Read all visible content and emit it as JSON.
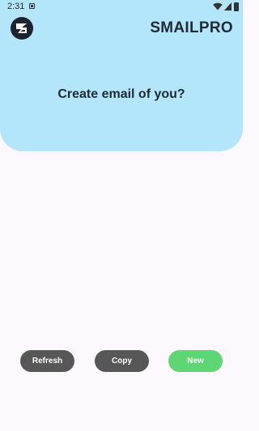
{
  "status_bar": {
    "time": "2:31"
  },
  "header": {
    "app_title": "SMAILPRO",
    "headline": "Create email of you?"
  },
  "actions": {
    "refresh_label": "Refresh",
    "copy_label": "Copy",
    "new_label": "New"
  },
  "colors": {
    "header_bg": "#b3e5fb",
    "page_bg": "#fdf8fd",
    "neutral_button": "#575757",
    "accent_button": "#5dd673"
  },
  "icons": {
    "logo": "smailpro-logo-icon",
    "notification": "notification-icon",
    "wifi": "wifi-icon",
    "signal": "signal-icon",
    "battery": "battery-icon"
  }
}
